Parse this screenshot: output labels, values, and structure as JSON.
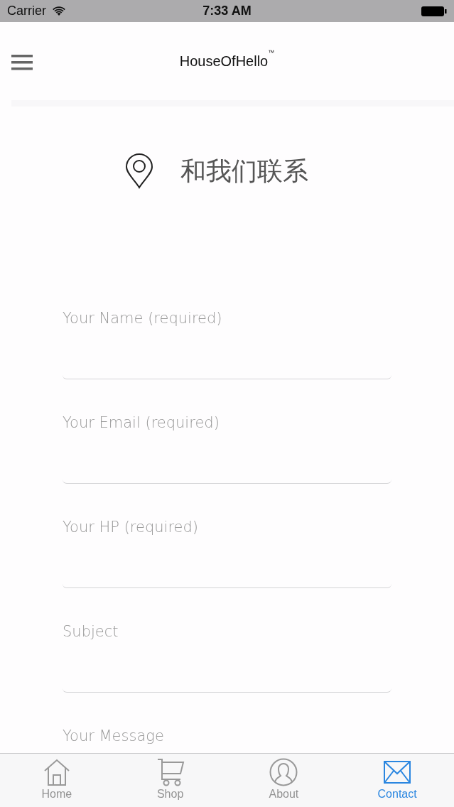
{
  "status_bar": {
    "carrier": "Carrier",
    "time": "7:33 AM"
  },
  "header": {
    "logo": "HouseOfHello$^{™}$"
  },
  "title": "和我们联系",
  "form": {
    "fields": [
      {
        "label": "Your Name (required)",
        "kind": "line"
      },
      {
        "label": "Your Email (required)",
        "kind": "line"
      },
      {
        "label": "Your HP (required)",
        "kind": "line"
      },
      {
        "label": "Subject",
        "kind": "line"
      },
      {
        "label": "Your Message",
        "kind": "area"
      }
    ]
  },
  "tab_bar": {
    "tabs": [
      {
        "label": "Home",
        "selected": false
      },
      {
        "label": "Shop",
        "selected": false
      },
      {
        "label": "About",
        "selected": false
      },
      {
        "label": "Contact",
        "selected": true
      }
    ]
  }
}
